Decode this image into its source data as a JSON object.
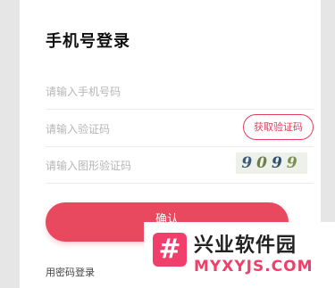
{
  "header": {
    "title": "手机号登录"
  },
  "form": {
    "phone_placeholder": "请输入手机号码",
    "code_placeholder": "请输入验证码",
    "get_code_label": "获取验证码",
    "captcha_placeholder": "请输入图形验证码",
    "captcha_digits": [
      "9",
      "0",
      "9",
      "9"
    ],
    "confirm_label": "确认",
    "password_login_label": "用密码登录"
  },
  "watermark": {
    "logo_glyph": "#",
    "name_cn": "兴业软件园",
    "name_en": "MYXYJS.COM"
  },
  "colors": {
    "accent": "#e8495e",
    "watermark_brand": "#f03f6a"
  }
}
